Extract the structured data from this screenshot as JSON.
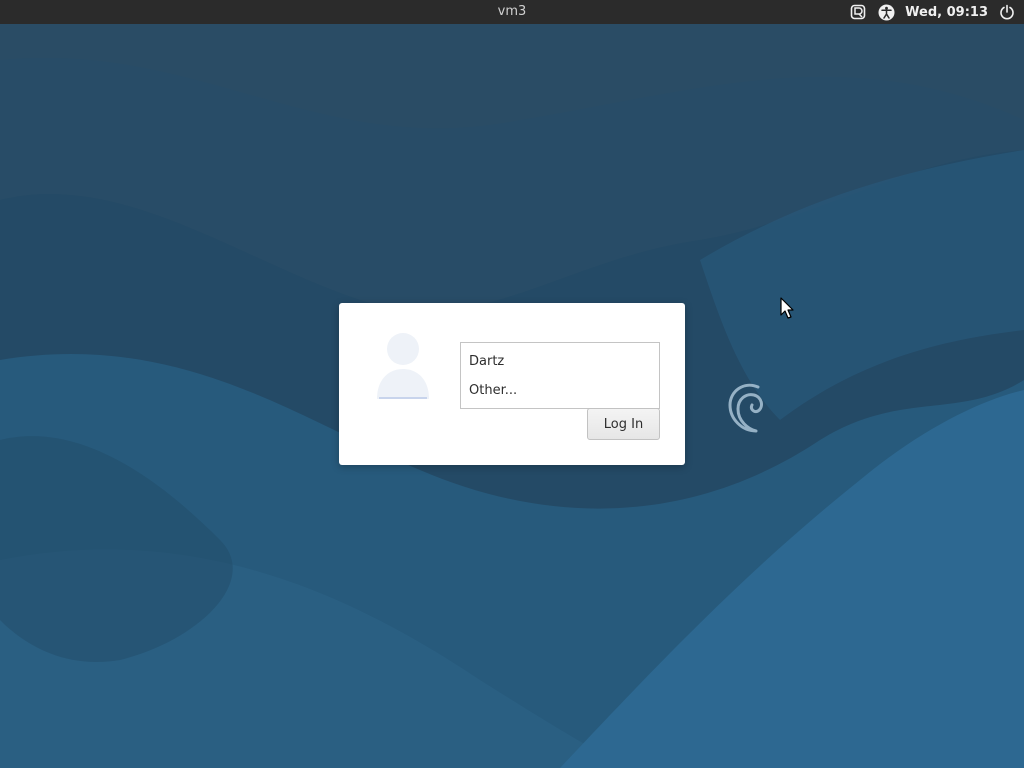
{
  "topbar": {
    "hostname": "vm3",
    "clock": "Wed, 09:13",
    "icons": [
      "screen-recording-icon",
      "accessibility-icon",
      "power-icon"
    ]
  },
  "login": {
    "users": [
      {
        "label": "Dartz"
      },
      {
        "label": "Other..."
      }
    ],
    "login_button": "Log In"
  },
  "theme": {
    "topbar_bg": "#2b2b2b",
    "wallpaper_dark": "#1f3f58",
    "wallpaper_mid": "#254f6c",
    "wallpaper_light": "#2f6a91",
    "dialog_bg": "#ffffff"
  }
}
